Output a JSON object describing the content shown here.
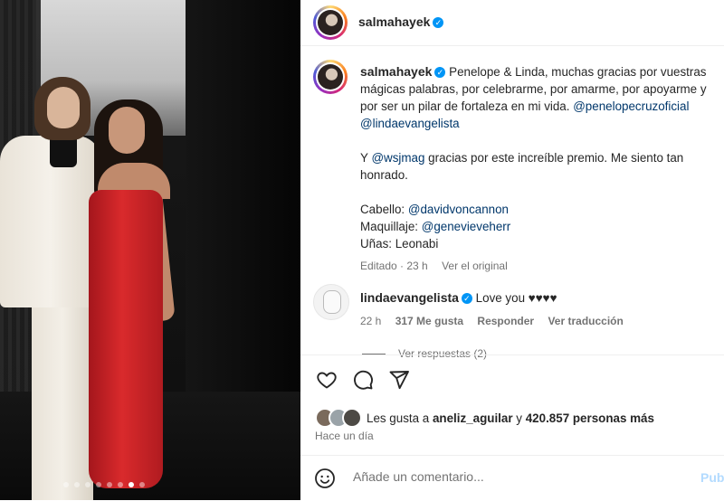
{
  "post": {
    "author": "salmahayek",
    "carousel": {
      "total_slides": 8,
      "active_index": 6
    }
  },
  "caption": {
    "author": "salmahayek",
    "line1": "Penelope & Linda, muchas gracias por vuestras",
    "line2": "mágicas palabras, por celebrarme, por amarme, por apoyarme y",
    "line3": "por ser un pilar de fortaleza en mi vida.",
    "mention_penelope": "@penelopecruzoficial",
    "mention_linda": "@lindaevangelista",
    "para2_prefix": "Y",
    "mention_wsj": "@wsjmag",
    "para2_rest": "gracias por este increíble premio. Me siento tan",
    "para2_line2": "honrado.",
    "hair_label": "Cabello:",
    "mention_hair": "@davidvoncannon",
    "makeup_label": "Maquillaje:",
    "mention_makeup": "@genevieveherr",
    "nails": "Uñas: Leonabi",
    "edited": "Editado · 23 h",
    "see_original": "Ver el original"
  },
  "comment": {
    "author": "lindaevangelista",
    "text": "Love you ♥♥♥♥",
    "time": "22 h",
    "likes": "317 Me gusta",
    "reply": "Responder",
    "translate": "Ver traducción",
    "view_replies": "Ver respuestas (2)"
  },
  "actions": {
    "likes_prefix": "Les gusta a",
    "liker": "aneliz_aguilar",
    "likes_joiner": "y",
    "likes_count": "420.857 personas más",
    "timestamp": "Hace un día"
  },
  "add_comment": {
    "placeholder": "Añade un comentario...",
    "publish": "Pub"
  },
  "colors": {
    "link": "#00376b",
    "verified": "#0095f6",
    "publish_disabled": "#b3dbff"
  }
}
